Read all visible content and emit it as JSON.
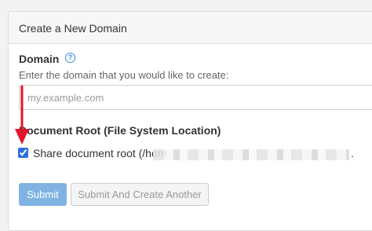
{
  "panel": {
    "title": "Create a New Domain"
  },
  "domain": {
    "label": "Domain",
    "help_icon": "question-circle-icon",
    "help_glyph": "?",
    "hint": "Enter the domain that you would like to create:",
    "input_value": "",
    "placeholder": "my.example.com"
  },
  "document_root": {
    "label": "Document Root (File System Location)",
    "share_checkbox_checked": true,
    "share_label": "Share document root (/hom",
    "trailing": "."
  },
  "buttons": {
    "submit": "Submit",
    "submit_and_create_another": "Submit And Create Another"
  },
  "annotation": {
    "arrow_color": "#e0162b"
  },
  "colors": {
    "primary_disabled": "#80b3e3",
    "help_icon": "#3a8dde"
  }
}
